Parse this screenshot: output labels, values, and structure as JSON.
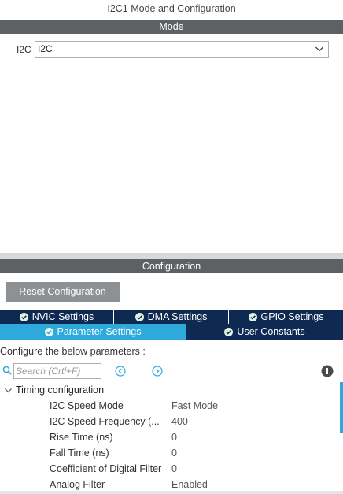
{
  "window": {
    "title": "I2C1 Mode and Configuration"
  },
  "mode": {
    "section_label": "Mode",
    "field_label": "I2C",
    "selected_value": "I2C"
  },
  "configuration": {
    "section_label": "Configuration",
    "reset_button_label": "Reset Configuration",
    "tabs_row1": [
      {
        "label": "NVIC Settings",
        "status": "ok"
      },
      {
        "label": "DMA Settings",
        "status": "ok"
      },
      {
        "label": "GPIO Settings",
        "status": "ok"
      }
    ],
    "tabs_row2": [
      {
        "label": "Parameter Settings",
        "status": "ok",
        "active": true
      },
      {
        "label": "User Constants",
        "status": "ok",
        "active": false
      }
    ],
    "instructions": "Configure the below parameters :",
    "search": {
      "placeholder": "Search (Crtl+F)"
    },
    "group": {
      "label": "Timing configuration",
      "expanded": true,
      "params": [
        {
          "name": "I2C Speed Mode",
          "value": "Fast Mode"
        },
        {
          "name": "I2C Speed Frequency (...",
          "value": "400"
        },
        {
          "name": "Rise Time (ns)",
          "value": "0"
        },
        {
          "name": "Fall Time (ns)",
          "value": "0"
        },
        {
          "name": "Coefficient of Digital Filter",
          "value": "0"
        },
        {
          "name": "Analog Filter",
          "value": "Enabled"
        }
      ]
    }
  },
  "colors": {
    "section_bar": "#5e6163",
    "tab_dark": "#0e2a52",
    "tab_active": "#2da9dc",
    "status_ok": "#2e9e44",
    "reset_button": "#8d9193"
  },
  "icons": {
    "select_arrow": "chevron-down-icon",
    "tab_status": "check-circle-icon",
    "search": "search-icon",
    "prev": "chevron-left-circle-icon",
    "next": "chevron-right-circle-icon",
    "info": "info-icon",
    "group_toggle": "chevron-down-icon"
  }
}
